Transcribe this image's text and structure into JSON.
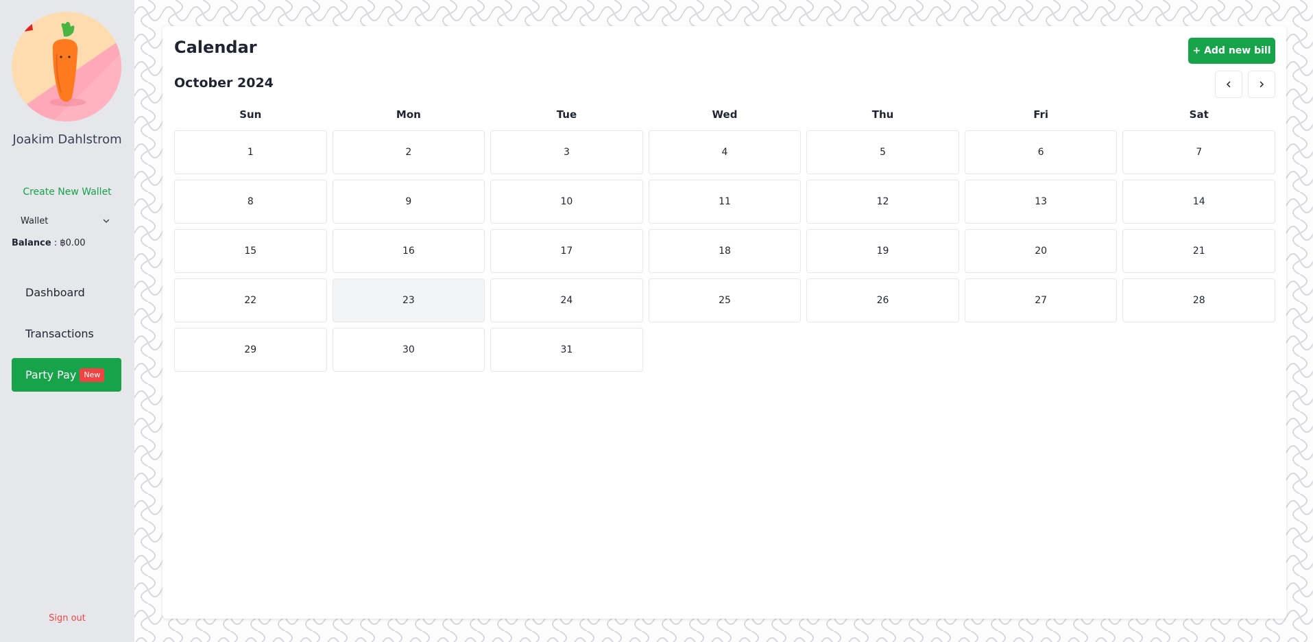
{
  "user": {
    "name": "Joakim Dahlstrom"
  },
  "wallet": {
    "create_label": "Create New Wallet",
    "selected": "Wallet",
    "balance_label": "Balance",
    "balance_sep": " : ",
    "balance_value": "฿0.00"
  },
  "nav": {
    "dashboard": "Dashboard",
    "transactions": "Transactions",
    "party_pay": "Party Pay",
    "party_pay_badge": "New",
    "sign_out": "Sign out"
  },
  "calendar": {
    "title": "Calendar",
    "add_bill_label": "+ Add new bill",
    "month_label": "October 2024",
    "weekdays": [
      "Sun",
      "Mon",
      "Tue",
      "Wed",
      "Thu",
      "Fri",
      "Sat"
    ],
    "days": [
      "1",
      "2",
      "3",
      "4",
      "5",
      "6",
      "7",
      "8",
      "9",
      "10",
      "11",
      "12",
      "13",
      "14",
      "15",
      "16",
      "17",
      "18",
      "19",
      "20",
      "21",
      "22",
      "23",
      "24",
      "25",
      "26",
      "27",
      "28",
      "29",
      "30",
      "31"
    ],
    "highlighted_day": "23"
  },
  "colors": {
    "accent": "#16a34a",
    "danger": "#ef4444",
    "sidebar_bg": "#e5e7eb",
    "today_bg": "#f3f4f6"
  },
  "icons": {
    "avatar": "carrot-plush-avatar",
    "wallet_dropdown": "chevron-down-icon",
    "prev": "chevron-left-icon",
    "next": "chevron-right-icon"
  }
}
